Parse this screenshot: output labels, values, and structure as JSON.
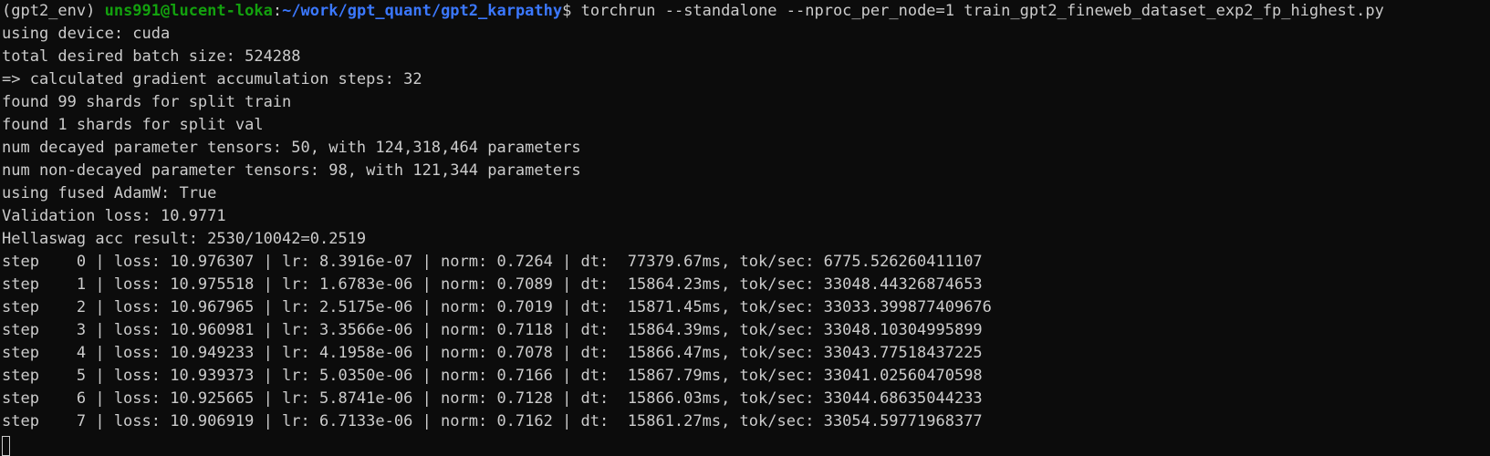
{
  "prompt": {
    "env": "(gpt2_env) ",
    "user_host": "uns991@lucent-loka",
    "colon": ":",
    "path": "~/work/gpt_quant/gpt2_karpathy",
    "dollar": "$ ",
    "command": "torchrun --standalone --nproc_per_node=1 train_gpt2_fineweb_dataset_exp2_fp_highest.py"
  },
  "output_lines": [
    "using device: cuda",
    "total desired batch size: 524288",
    "=> calculated gradient accumulation steps: 32",
    "found 99 shards for split train",
    "found 1 shards for split val",
    "num decayed parameter tensors: 50, with 124,318,464 parameters",
    "num non-decayed parameter tensors: 98, with 121,344 parameters",
    "using fused AdamW: True",
    "Validation loss: 10.9771",
    "Hellaswag acc result: 2530/10042=0.2519",
    "step    0 | loss: 10.976307 | lr: 8.3916e-07 | norm: 0.7264 | dt:  77379.67ms, tok/sec: 6775.526260411107",
    "step    1 | loss: 10.975518 | lr: 1.6783e-06 | norm: 0.7089 | dt:  15864.23ms, tok/sec: 33048.44326874653",
    "step    2 | loss: 10.967965 | lr: 2.5175e-06 | norm: 0.7019 | dt:  15871.45ms, tok/sec: 33033.399877409676",
    "step    3 | loss: 10.960981 | lr: 3.3566e-06 | norm: 0.7118 | dt:  15864.39ms, tok/sec: 33048.10304995899",
    "step    4 | loss: 10.949233 | lr: 4.1958e-06 | norm: 0.7078 | dt:  15866.47ms, tok/sec: 33043.77518437225",
    "step    5 | loss: 10.939373 | lr: 5.0350e-06 | norm: 0.7166 | dt:  15867.79ms, tok/sec: 33041.02560470598",
    "step    6 | loss: 10.925665 | lr: 5.8741e-06 | norm: 0.7128 | dt:  15866.03ms, tok/sec: 33044.68635044233",
    "step    7 | loss: 10.906919 | lr: 6.7133e-06 | norm: 0.7162 | dt:  15861.27ms, tok/sec: 33054.59771968377"
  ]
}
